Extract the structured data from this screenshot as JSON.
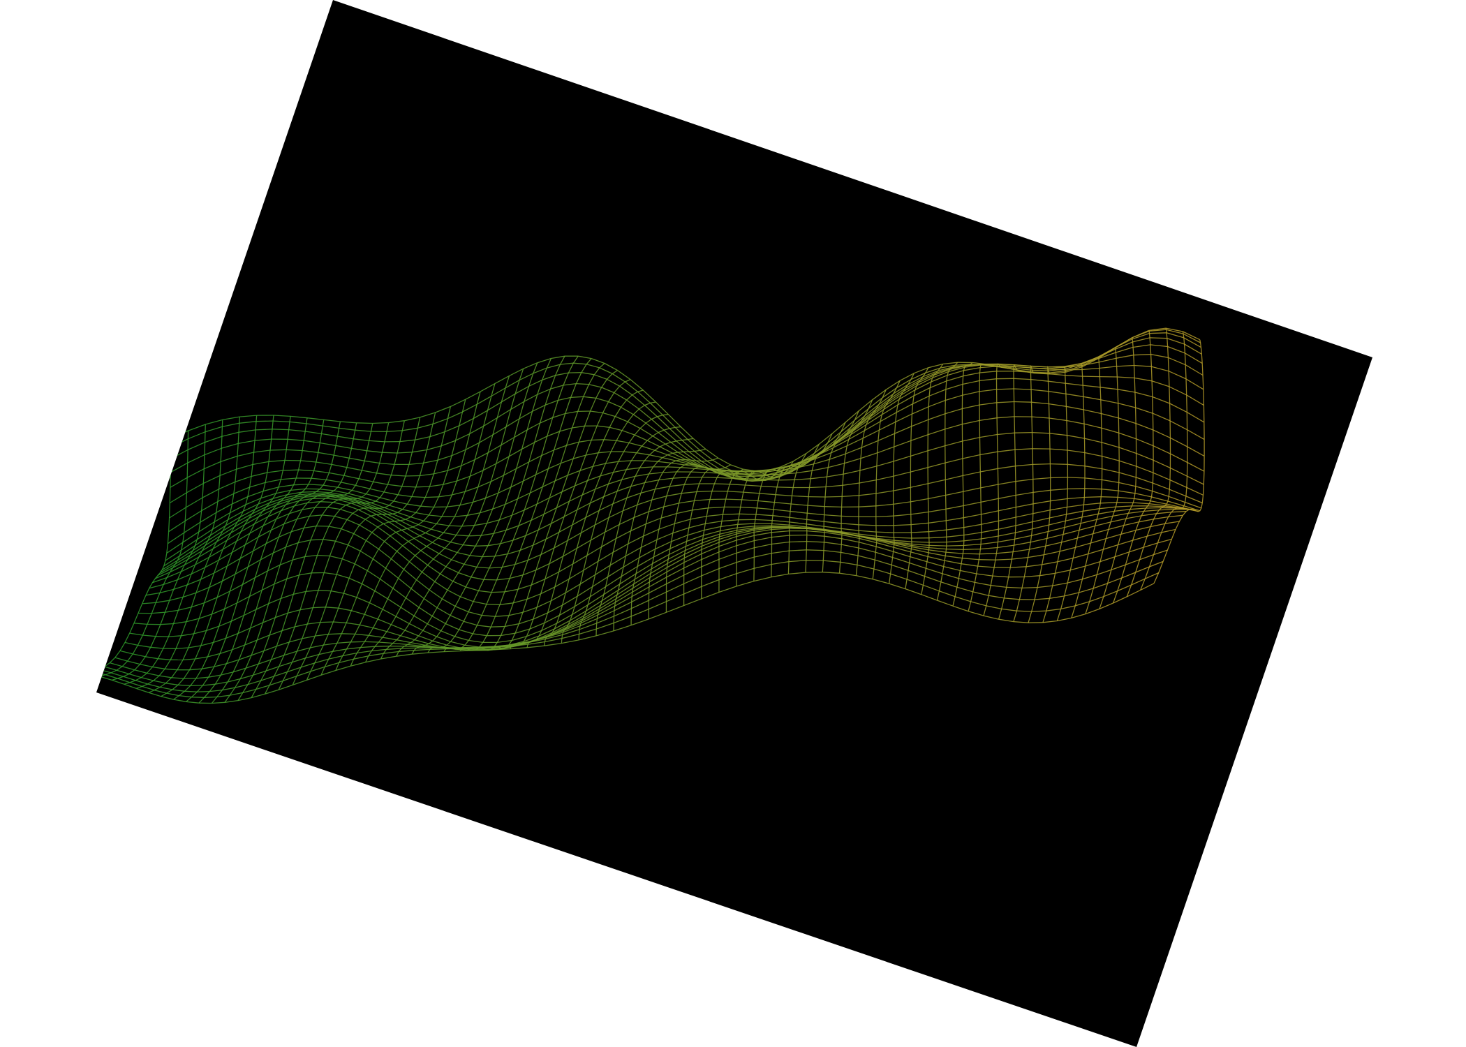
{
  "scene": {
    "background_color": "#ffffff",
    "panel_color": "#000000",
    "mesh_color_start": "#2e9a2a",
    "mesh_color_end": "#b49a28"
  }
}
